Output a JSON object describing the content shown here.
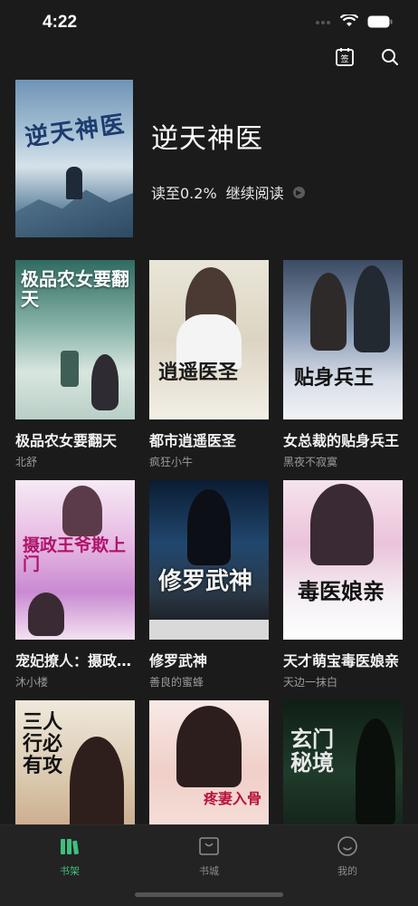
{
  "status_bar": {
    "time": "4:22"
  },
  "featured": {
    "cover_text": "逆天神医",
    "title": "逆天神医",
    "progress_text": "读至0.2%",
    "continue_label": "继续阅读"
  },
  "books": [
    {
      "title": "极品农女要翻天",
      "author": "北舒",
      "cover_text": "极品农女要翻天"
    },
    {
      "title": "都市逍遥医圣",
      "author": "疯狂小牛",
      "cover_text": "逍遥医圣"
    },
    {
      "title": "女总裁的贴身兵王",
      "author": "黑夜不寂寞",
      "cover_text": "贴身兵王"
    },
    {
      "title": "宠妃撩人：摄政王爷欺上门",
      "author": "沐小楼",
      "cover_text": "摄政王爷欺上门"
    },
    {
      "title": "修罗武神",
      "author": "善良的蜜蜂",
      "cover_text": "修罗武神"
    },
    {
      "title": "天才萌宝毒医娘亲",
      "author": "天边一抹白",
      "cover_text": "毒医娘亲"
    },
    {
      "title": "",
      "author": "",
      "cover_text": "三人行必有攻"
    },
    {
      "title": "",
      "author": "",
      "cover_text": "疼妻入骨"
    },
    {
      "title": "",
      "author": "",
      "cover_text": "玄门秘境"
    }
  ],
  "tabs": [
    {
      "label": "书架",
      "active": true,
      "icon": "bookshelf-icon"
    },
    {
      "label": "书城",
      "active": false,
      "icon": "store-icon"
    },
    {
      "label": "我的",
      "active": false,
      "icon": "profile-icon"
    }
  ],
  "colors": {
    "accent": "#3fbf7f",
    "background": "#1b1b1b",
    "tab_bar": "#232323"
  }
}
